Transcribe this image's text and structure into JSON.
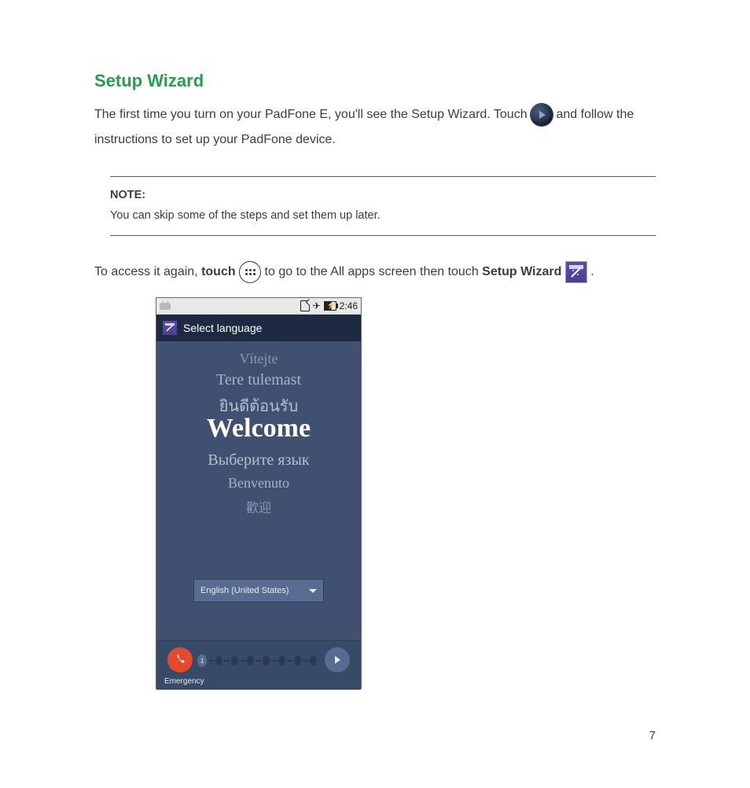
{
  "heading": "Setup Wizard",
  "para1_a": "The first time you turn on your PadFone E, you'll see the Setup Wizard. Touch ",
  "para1_b": " and follow the instructions to set up your PadFone device.",
  "note_label": "NOTE:",
  "note_text": "You can skip some of the steps and set them up later.",
  "para2_a": "To access it again, ",
  "para2_touch": "touch",
  "para2_b": " to go to the All apps screen then touch ",
  "para2_setup": "Setup Wizard",
  "para2_c": ".",
  "phone": {
    "status_time": "2:46",
    "title": "Select language",
    "langs": {
      "l1": "Vítejte",
      "l2": "Tere tulemast",
      "l3": "ยินดีต้อนรับ",
      "l4": "Welcome",
      "l5": "Выберите язык",
      "l6": "Benvenuto",
      "l7": "歡迎"
    },
    "dropdown": "English (United States)",
    "emergency": "Emergency",
    "step1": "1"
  },
  "page_number": "7"
}
